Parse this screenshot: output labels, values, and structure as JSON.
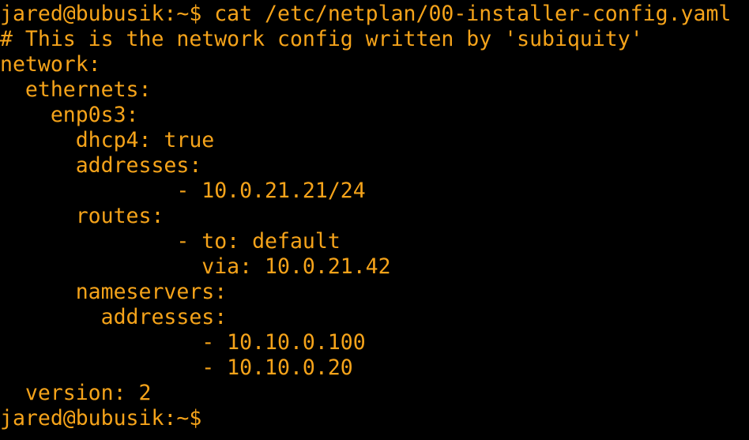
{
  "colors": {
    "background": "#000000",
    "text": "#F5A31A"
  },
  "terminal": {
    "lines": [
      "jared@bubusik:~$ cat /etc/netplan/00-installer-config.yaml",
      "# This is the network config written by 'subiquity'",
      "network:",
      "  ethernets:",
      "    enp0s3:",
      "      dhcp4: true",
      "      addresses:",
      "              - 10.0.21.21/24",
      "      routes:",
      "              - to: default",
      "                via: 10.0.21.42",
      "      nameservers:",
      "        addresses:",
      "                - 10.10.0.100",
      "                - 10.10.0.20",
      "  version: 2",
      "jared@bubusik:~$"
    ]
  }
}
